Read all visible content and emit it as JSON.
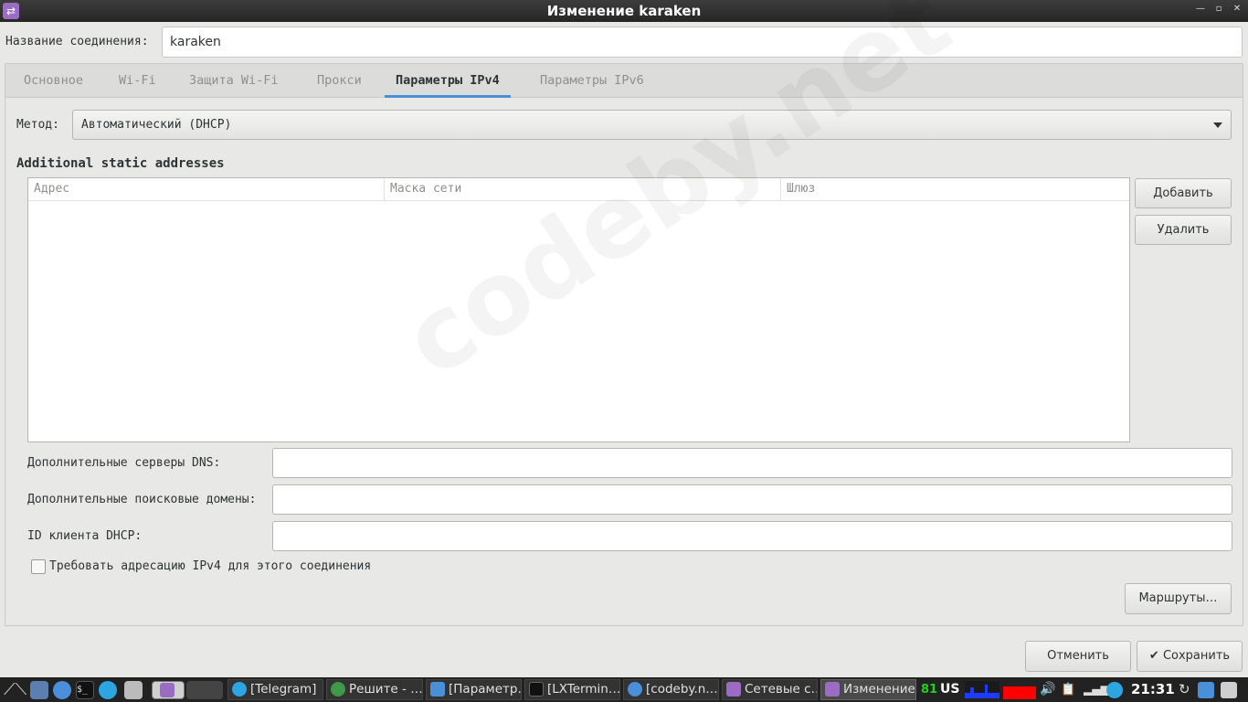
{
  "window": {
    "title": "Изменение karaken",
    "app_icon": "network-connection-icon",
    "controls": {
      "minimize": "—",
      "maximize": "▫",
      "close": "✕"
    }
  },
  "connection": {
    "label": "Название соединения:",
    "value": "karaken"
  },
  "tabs": [
    {
      "label": "Основное",
      "active": false
    },
    {
      "label": "Wi-Fi",
      "active": false
    },
    {
      "label": "Защита Wi-Fi",
      "active": false
    },
    {
      "label": "Прокси",
      "active": false
    },
    {
      "label": "Параметры IPv4",
      "active": true
    },
    {
      "label": "Параметры IPv6",
      "active": false
    }
  ],
  "ipv4": {
    "method_label": "Метод:",
    "method_value": "Автоматический (DHCP)",
    "section_title": "Additional static addresses",
    "columns": [
      "Адрес",
      "Маска сети",
      "Шлюз"
    ],
    "rows": [],
    "add_button": "Добавить",
    "delete_button": "Удалить",
    "dns_label": "Дополнительные серверы DNS:",
    "dns_value": "",
    "search_domains_label": "Дополнительные поисковые домены:",
    "search_domains_value": "",
    "dhcp_client_id_label": "ID клиента DHCP:",
    "dhcp_client_id_value": "",
    "require_ipv4_label": "Требовать адресацию IPv4 для этого соединения",
    "require_ipv4_checked": false,
    "routes_button": "Маршруты…"
  },
  "footer": {
    "cancel_button": "Отменить",
    "save_button": "Сохранить",
    "save_icon": "checkmark-icon"
  },
  "watermark": "codeby.net",
  "taskbar": {
    "tasks": [
      {
        "label": "[Telegram]",
        "icon": "telegram-icon",
        "color": "#2ca5e0"
      },
      {
        "label": "Решите - …",
        "icon": "globe-icon",
        "color": "#3e9a4a"
      },
      {
        "label": "[Параметр…",
        "icon": "user-icon",
        "color": "#4a90d9"
      },
      {
        "label": "[LXTermin…",
        "icon": "terminal-icon",
        "color": "#111111"
      },
      {
        "label": "[codeby.n…",
        "icon": "chromium-icon",
        "color": "#4a8fd9"
      },
      {
        "label": "Сетевые с…",
        "icon": "network-icon",
        "color": "#9b6cc4"
      },
      {
        "label": "Изменение…",
        "icon": "network-icon",
        "color": "#9b6cc4"
      }
    ],
    "cpu_temp": "81",
    "keyboard_layout": "US",
    "clock": "21:31",
    "colors": {
      "cpu_graph": "#1f3bff",
      "net_graph": "#ff0000",
      "temp": "#20d020"
    }
  }
}
